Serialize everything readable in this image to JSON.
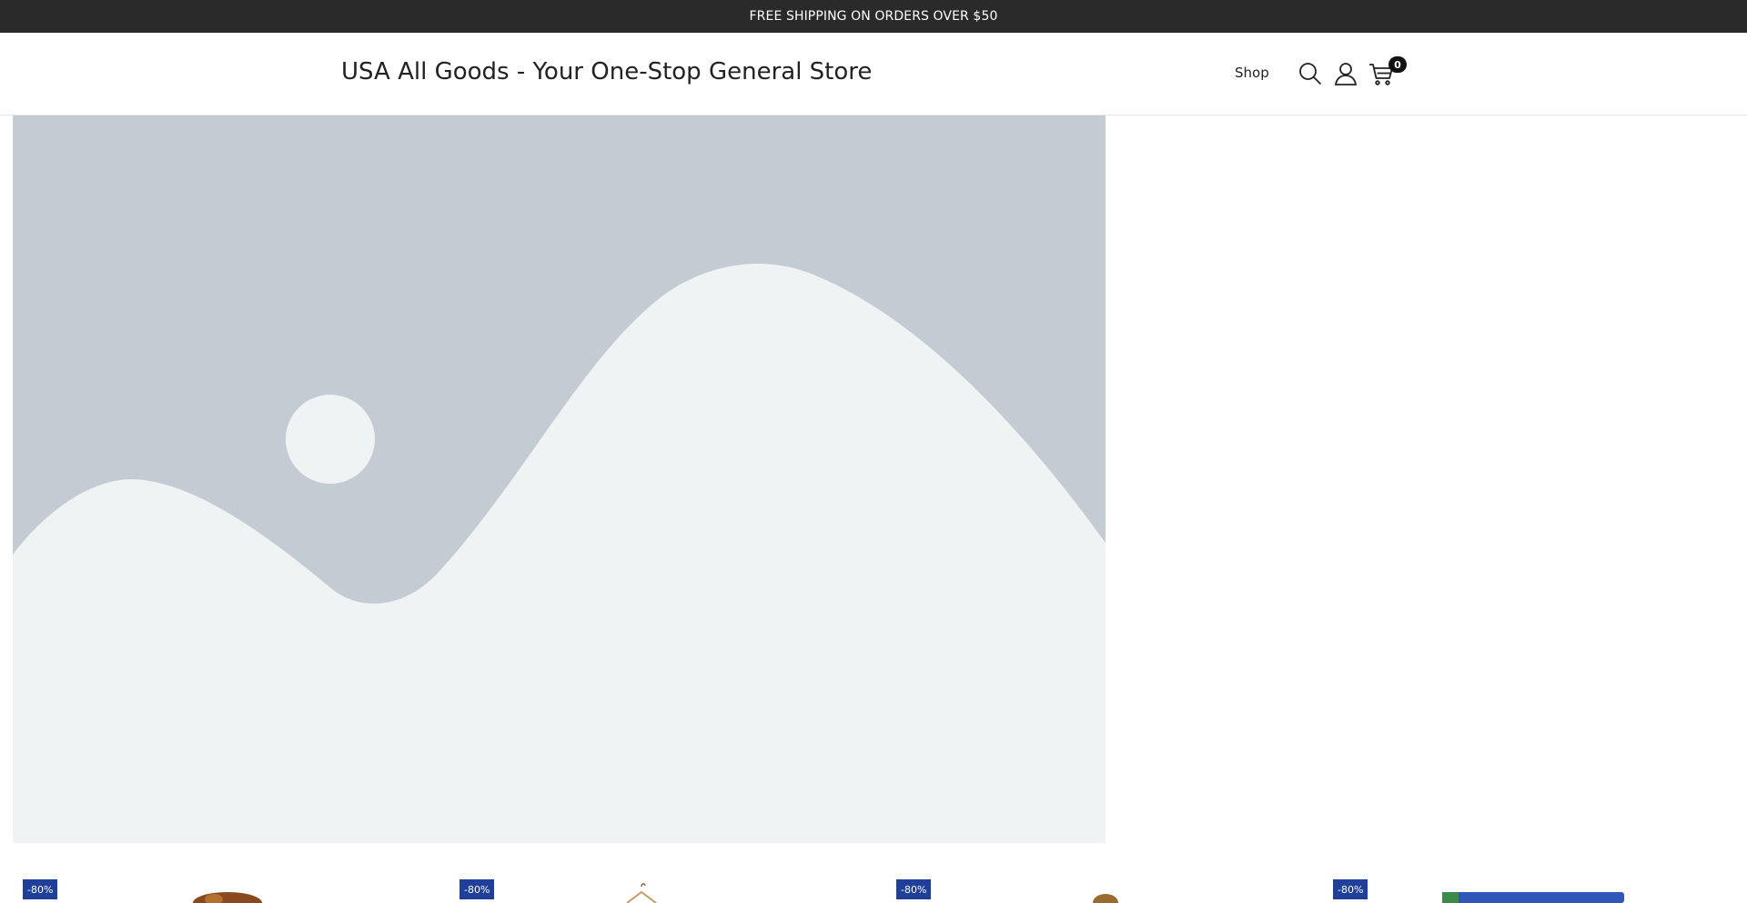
{
  "announcement": {
    "text": "FREE SHIPPING ON ORDERS OVER $50"
  },
  "header": {
    "site_title": "USA All Goods - Your One-Stop General Store",
    "nav": [
      {
        "label": "Shop"
      }
    ],
    "icons": [
      "search-icon",
      "user-icon",
      "cart-icon"
    ],
    "cart_count": "0"
  },
  "hero": {
    "image": "placeholder-landscape-image"
  },
  "products": [
    {
      "badge": "-80%",
      "image": "dog-product-image"
    },
    {
      "badge": "-80%",
      "image": "hanger-product-image"
    },
    {
      "badge": "-80%",
      "image": "brown-product-image"
    },
    {
      "badge": "-80%",
      "image": "blue-product-image"
    }
  ],
  "colors": {
    "announcement_bg": "#2a2a2a",
    "badge_bg": "#1f3f9b",
    "placeholder_bg": "#c4ccd3",
    "placeholder_fg": "#f0f3f4"
  }
}
